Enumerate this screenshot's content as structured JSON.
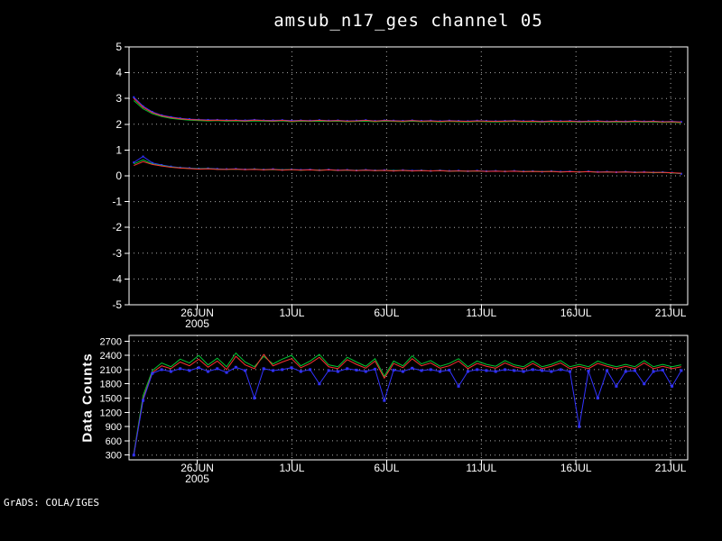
{
  "title": "amsub_n17_ges channel 05",
  "footer": "GrADS: COLA/IGES",
  "colors": {
    "background": "#000000",
    "foreground": "#ffffff",
    "grid": "#aaaaaa",
    "red": "#fa3232",
    "green": "#00c832",
    "blue": "#3232ff"
  },
  "chart_data": [
    {
      "type": "line",
      "title": "amsub_n17_ges channel 05",
      "xlabel": "",
      "ylabel": "",
      "xlim": [
        0,
        29.5
      ],
      "ylim": [
        -5,
        5
      ],
      "y_ticks": [
        5,
        4,
        3,
        2,
        1,
        0,
        -1,
        -2,
        -3,
        -4,
        -5
      ],
      "x_ticks": [
        {
          "pos": 3.6,
          "label": "26JUN",
          "sub": "2005"
        },
        {
          "pos": 8.6,
          "label": "1JUL"
        },
        {
          "pos": 13.6,
          "label": "6JUL"
        },
        {
          "pos": 18.6,
          "label": "11JUL"
        },
        {
          "pos": 23.6,
          "label": "16JUL"
        },
        {
          "pos": 28.6,
          "label": "21JUL"
        }
      ],
      "x_start": 0.25,
      "x_step": 0.49,
      "series": [
        {
          "name": "blue-upper",
          "color": "blue",
          "marker": true,
          "marker_size": 2,
          "values": [
            3.05,
            2.7,
            2.48,
            2.35,
            2.28,
            2.23,
            2.2,
            2.18,
            2.17,
            2.17,
            2.16,
            2.16,
            2.15,
            2.17,
            2.15,
            2.15,
            2.16,
            2.14,
            2.15,
            2.14,
            2.16,
            2.14,
            2.15,
            2.13,
            2.14,
            2.16,
            2.13,
            2.15,
            2.14,
            2.13,
            2.15,
            2.13,
            2.14,
            2.12,
            2.14,
            2.13,
            2.12,
            2.14,
            2.13,
            2.12,
            2.13,
            2.14,
            2.12,
            2.13,
            2.11,
            2.13,
            2.12,
            2.13,
            2.11,
            2.12,
            2.13,
            2.11,
            2.12,
            2.11,
            2.13,
            2.11,
            2.12,
            2.1,
            2.11,
            2.09
          ]
        },
        {
          "name": "green-upper",
          "color": "green",
          "marker": false,
          "marker_size": 0,
          "values": [
            2.92,
            2.6,
            2.41,
            2.3,
            2.23,
            2.19,
            2.16,
            2.14,
            2.13,
            2.14,
            2.12,
            2.13,
            2.11,
            2.13,
            2.12,
            2.11,
            2.13,
            2.1,
            2.12,
            2.11,
            2.12,
            2.11,
            2.12,
            2.1,
            2.11,
            2.12,
            2.1,
            2.12,
            2.11,
            2.1,
            2.12,
            2.1,
            2.11,
            2.09,
            2.11,
            2.1,
            2.09,
            2.11,
            2.1,
            2.09,
            2.1,
            2.11,
            2.09,
            2.1,
            2.08,
            2.1,
            2.09,
            2.1,
            2.08,
            2.09,
            2.1,
            2.08,
            2.09,
            2.08,
            2.1,
            2.08,
            2.09,
            2.07,
            2.08,
            2.06
          ]
        },
        {
          "name": "red-upper",
          "color": "red",
          "marker": false,
          "marker_size": 0,
          "values": [
            3.0,
            2.66,
            2.45,
            2.33,
            2.26,
            2.21,
            2.18,
            2.17,
            2.15,
            2.16,
            2.14,
            2.15,
            2.13,
            2.16,
            2.14,
            2.13,
            2.15,
            2.12,
            2.14,
            2.13,
            2.15,
            2.13,
            2.14,
            2.12,
            2.13,
            2.15,
            2.12,
            2.14,
            2.13,
            2.12,
            2.14,
            2.12,
            2.13,
            2.11,
            2.13,
            2.12,
            2.11,
            2.13,
            2.12,
            2.11,
            2.12,
            2.13,
            2.11,
            2.12,
            2.1,
            2.12,
            2.11,
            2.12,
            2.1,
            2.11,
            2.12,
            2.1,
            2.11,
            2.1,
            2.12,
            2.1,
            2.11,
            2.09,
            2.1,
            2.08
          ]
        },
        {
          "name": "blue-lower",
          "color": "blue",
          "marker": true,
          "marker_size": 2,
          "values": [
            0.52,
            0.75,
            0.5,
            0.42,
            0.36,
            0.32,
            0.3,
            0.28,
            0.29,
            0.27,
            0.26,
            0.27,
            0.25,
            0.26,
            0.24,
            0.26,
            0.23,
            0.25,
            0.23,
            0.24,
            0.22,
            0.24,
            0.22,
            0.23,
            0.21,
            0.23,
            0.21,
            0.22,
            0.2,
            0.22,
            0.2,
            0.21,
            0.19,
            0.21,
            0.19,
            0.2,
            0.18,
            0.2,
            0.18,
            0.19,
            0.17,
            0.19,
            0.17,
            0.18,
            0.16,
            0.18,
            0.16,
            0.17,
            0.15,
            0.17,
            0.15,
            0.16,
            0.14,
            0.16,
            0.14,
            0.15,
            0.13,
            0.14,
            0.12,
            0.08
          ]
        },
        {
          "name": "green-lower",
          "color": "green",
          "marker": false,
          "marker_size": 0,
          "values": [
            0.46,
            0.62,
            0.46,
            0.4,
            0.34,
            0.31,
            0.29,
            0.27,
            0.28,
            0.26,
            0.25,
            0.26,
            0.24,
            0.26,
            0.23,
            0.24,
            0.23,
            0.24,
            0.22,
            0.23,
            0.22,
            0.23,
            0.21,
            0.22,
            0.21,
            0.22,
            0.2,
            0.21,
            0.2,
            0.21,
            0.19,
            0.2,
            0.19,
            0.2,
            0.18,
            0.19,
            0.18,
            0.19,
            0.17,
            0.18,
            0.17,
            0.18,
            0.16,
            0.17,
            0.16,
            0.17,
            0.15,
            0.16,
            0.15,
            0.16,
            0.14,
            0.15,
            0.14,
            0.15,
            0.13,
            0.14,
            0.12,
            0.13,
            0.11,
            0.09
          ]
        },
        {
          "name": "red-lower",
          "color": "red",
          "marker": false,
          "marker_size": 0,
          "values": [
            0.4,
            0.55,
            0.44,
            0.38,
            0.33,
            0.3,
            0.28,
            0.26,
            0.27,
            0.25,
            0.25,
            0.26,
            0.24,
            0.25,
            0.23,
            0.25,
            0.22,
            0.24,
            0.22,
            0.23,
            0.21,
            0.23,
            0.21,
            0.22,
            0.2,
            0.22,
            0.2,
            0.21,
            0.19,
            0.21,
            0.19,
            0.2,
            0.19,
            0.2,
            0.18,
            0.19,
            0.18,
            0.19,
            0.17,
            0.18,
            0.17,
            0.18,
            0.16,
            0.17,
            0.16,
            0.17,
            0.15,
            0.16,
            0.15,
            0.16,
            0.14,
            0.15,
            0.14,
            0.15,
            0.13,
            0.14,
            0.13,
            0.13,
            0.12,
            0.1
          ]
        }
      ]
    },
    {
      "type": "line",
      "title": "",
      "xlabel": "",
      "ylabel": "Data Counts",
      "xlim": [
        0,
        29.5
      ],
      "ylim": [
        200,
        2820
      ],
      "y_ticks": [
        2700,
        2400,
        2100,
        1800,
        1500,
        1200,
        900,
        600,
        300
      ],
      "x_ticks": [
        {
          "pos": 3.6,
          "label": "26JUN",
          "sub": "2005"
        },
        {
          "pos": 8.6,
          "label": "1JUL"
        },
        {
          "pos": 13.6,
          "label": "6JUL"
        },
        {
          "pos": 18.6,
          "label": "11JUL"
        },
        {
          "pos": 23.6,
          "label": "16JUL"
        },
        {
          "pos": 28.6,
          "label": "21JUL"
        }
      ],
      "x_start": 0.25,
      "x_step": 0.49,
      "series": [
        {
          "name": "green-counts",
          "color": "green",
          "marker": false,
          "marker_size": 0,
          "values": [
            330,
            1550,
            2080,
            2240,
            2160,
            2320,
            2240,
            2400,
            2200,
            2340,
            2160,
            2450,
            2260,
            2160,
            2380,
            2220,
            2320,
            2400,
            2180,
            2280,
            2420,
            2200,
            2160,
            2360,
            2260,
            2170,
            2330,
            1960,
            2280,
            2180,
            2390,
            2220,
            2290,
            2170,
            2230,
            2330,
            2160,
            2280,
            2210,
            2170,
            2290,
            2200,
            2160,
            2280,
            2160,
            2210,
            2290,
            2160,
            2210,
            2160,
            2280,
            2210,
            2160,
            2210,
            2160,
            2290,
            2160,
            2210,
            2160,
            2200
          ]
        },
        {
          "name": "red-counts",
          "color": "red",
          "marker": false,
          "marker_size": 0,
          "values": [
            310,
            1480,
            2040,
            2180,
            2120,
            2260,
            2180,
            2320,
            2150,
            2280,
            2100,
            2380,
            2200,
            2120,
            2420,
            2180,
            2260,
            2330,
            2140,
            2230,
            2360,
            2160,
            2120,
            2310,
            2210,
            2130,
            2280,
            1920,
            2230,
            2140,
            2330,
            2180,
            2240,
            2130,
            2180,
            2280,
            2120,
            2230,
            2170,
            2130,
            2240,
            2160,
            2120,
            2230,
            2120,
            2170,
            2240,
            2120,
            2170,
            2120,
            2230,
            2170,
            2120,
            2170,
            2120,
            2240,
            2120,
            2170,
            2120,
            2160
          ]
        },
        {
          "name": "blue-counts",
          "color": "blue",
          "marker": true,
          "marker_size": 3,
          "values": [
            300,
            1450,
            2020,
            2100,
            2060,
            2120,
            2080,
            2140,
            2060,
            2120,
            2040,
            2150,
            2080,
            1500,
            2120,
            2080,
            2100,
            2140,
            2060,
            2100,
            1800,
            2080,
            2060,
            2120,
            2090,
            2060,
            2110,
            1450,
            2090,
            2060,
            2130,
            2080,
            2100,
            2060,
            2090,
            1750,
            2060,
            2100,
            2080,
            2060,
            2100,
            2080,
            2060,
            2100,
            2080,
            2060,
            2100,
            2060,
            900,
            2070,
            1500,
            2080,
            1750,
            2060,
            2080,
            1800,
            2060,
            2090,
            1750,
            2080
          ]
        }
      ]
    }
  ]
}
